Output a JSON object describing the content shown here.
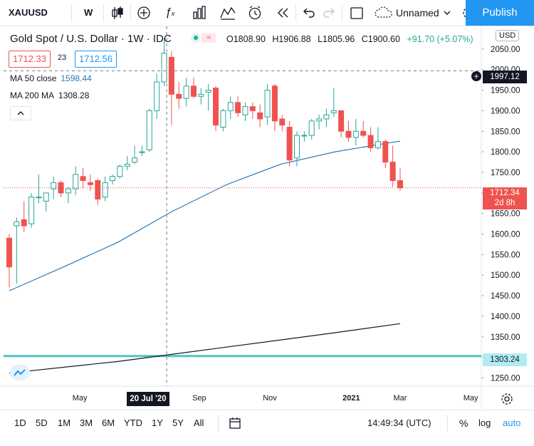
{
  "toolbar": {
    "symbol": "XAUUSD",
    "interval": "W",
    "layout_name": "Unnamed",
    "publish_label": "Publish"
  },
  "legend": {
    "title": "Gold Spot / U.S. Dollar · 1W · IDC",
    "open": "O1808.90",
    "high": "H1906.88",
    "low": "L1805.96",
    "close": "C1900.60",
    "change": "+91.70 (+5.07%)",
    "bid": "1712.33",
    "spread": "23",
    "ask": "1712.56",
    "ma50_label": "MA 50 close",
    "ma50_value": "1598.44",
    "ma200_label": "MA 200 MA",
    "ma200_value": "1308.28"
  },
  "axis": {
    "currency": "USD",
    "crosshair_price": "1997.12",
    "current_price": "1712.34",
    "countdown": "2d 8h",
    "line_price": "1303.24",
    "crosshair_date": "20 Jul '20"
  },
  "bottom": {
    "ranges": [
      "1D",
      "5D",
      "1M",
      "3M",
      "6M",
      "YTD",
      "1Y",
      "5Y",
      "All"
    ],
    "time": "14:49:34 (UTC)",
    "percent": "%",
    "log": "log",
    "auto": "auto"
  },
  "colors": {
    "up": "#26a69a",
    "down": "#ef5350",
    "ma50": "#2c7bb6",
    "ma200": "#131722",
    "hline": "#4fc3c8",
    "accent": "#2196f3"
  },
  "chart_data": {
    "type": "candlestick",
    "title": "Gold Spot / U.S. Dollar · 1W · IDC",
    "ylim": [
      1230,
      2100
    ],
    "y_ticks": [
      1250,
      1300,
      1350,
      1400,
      1450,
      1500,
      1550,
      1600,
      1650,
      1700,
      1750,
      1800,
      1850,
      1900,
      1950,
      2000,
      2050
    ],
    "x_ticks": [
      "May",
      "20 Jul '20",
      "Sep",
      "Nov",
      "2021",
      "Mar",
      "May"
    ],
    "x_tick_weeks": [
      13,
      29,
      35,
      48,
      63,
      72,
      85
    ],
    "week_count": 88,
    "candles": [
      {
        "o": 1590,
        "h": 1600,
        "l": 1470,
        "c": 1520
      },
      {
        "o": 1620,
        "h": 1640,
        "l": 1480,
        "c": 1630
      },
      {
        "o": 1635,
        "h": 1680,
        "l": 1605,
        "c": 1620
      },
      {
        "o": 1625,
        "h": 1700,
        "l": 1615,
        "c": 1690
      },
      {
        "o": 1690,
        "h": 1745,
        "l": 1675,
        "c": 1690
      },
      {
        "o": 1680,
        "h": 1695,
        "l": 1655,
        "c": 1700
      },
      {
        "o": 1710,
        "h": 1740,
        "l": 1685,
        "c": 1725
      },
      {
        "o": 1725,
        "h": 1730,
        "l": 1690,
        "c": 1700
      },
      {
        "o": 1700,
        "h": 1715,
        "l": 1675,
        "c": 1710
      },
      {
        "o": 1710,
        "h": 1765,
        "l": 1695,
        "c": 1745
      },
      {
        "o": 1740,
        "h": 1760,
        "l": 1710,
        "c": 1730
      },
      {
        "o": 1725,
        "h": 1745,
        "l": 1705,
        "c": 1720
      },
      {
        "o": 1730,
        "h": 1735,
        "l": 1670,
        "c": 1685
      },
      {
        "o": 1690,
        "h": 1740,
        "l": 1680,
        "c": 1725
      },
      {
        "o": 1730,
        "h": 1745,
        "l": 1720,
        "c": 1740
      },
      {
        "o": 1740,
        "h": 1770,
        "l": 1735,
        "c": 1765
      },
      {
        "o": 1765,
        "h": 1790,
        "l": 1755,
        "c": 1770
      },
      {
        "o": 1775,
        "h": 1815,
        "l": 1770,
        "c": 1785
      },
      {
        "o": 1800,
        "h": 1815,
        "l": 1790,
        "c": 1800
      },
      {
        "o": 1805,
        "h": 1905,
        "l": 1800,
        "c": 1900
      },
      {
        "o": 1900,
        "h": 1990,
        "l": 1880,
        "c": 1970
      },
      {
        "o": 1970,
        "h": 2075,
        "l": 1960,
        "c": 2040
      },
      {
        "o": 2030,
        "h": 2045,
        "l": 1865,
        "c": 1940
      },
      {
        "o": 1940,
        "h": 1970,
        "l": 1905,
        "c": 1930
      },
      {
        "o": 1930,
        "h": 1980,
        "l": 1910,
        "c": 1960
      },
      {
        "o": 1960,
        "h": 1980,
        "l": 1930,
        "c": 1935
      },
      {
        "o": 1935,
        "h": 1955,
        "l": 1915,
        "c": 1940
      },
      {
        "o": 1945,
        "h": 1965,
        "l": 1900,
        "c": 1950
      },
      {
        "o": 1955,
        "h": 1960,
        "l": 1850,
        "c": 1865
      },
      {
        "o": 1860,
        "h": 1905,
        "l": 1850,
        "c": 1900
      },
      {
        "o": 1900,
        "h": 1935,
        "l": 1880,
        "c": 1920
      },
      {
        "o": 1920,
        "h": 1935,
        "l": 1885,
        "c": 1895
      },
      {
        "o": 1890,
        "h": 1920,
        "l": 1875,
        "c": 1910
      },
      {
        "o": 1910,
        "h": 1920,
        "l": 1880,
        "c": 1900
      },
      {
        "o": 1895,
        "h": 1915,
        "l": 1860,
        "c": 1880
      },
      {
        "o": 1885,
        "h": 1965,
        "l": 1865,
        "c": 1950
      },
      {
        "o": 1960,
        "h": 1965,
        "l": 1850,
        "c": 1875
      },
      {
        "o": 1880,
        "h": 1890,
        "l": 1850,
        "c": 1865
      },
      {
        "o": 1860,
        "h": 1875,
        "l": 1765,
        "c": 1780
      },
      {
        "o": 1785,
        "h": 1850,
        "l": 1765,
        "c": 1840
      },
      {
        "o": 1840,
        "h": 1850,
        "l": 1825,
        "c": 1840
      },
      {
        "o": 1840,
        "h": 1880,
        "l": 1830,
        "c": 1875
      },
      {
        "o": 1875,
        "h": 1890,
        "l": 1855,
        "c": 1880
      },
      {
        "o": 1880,
        "h": 1905,
        "l": 1860,
        "c": 1890
      },
      {
        "o": 1895,
        "h": 1955,
        "l": 1885,
        "c": 1900
      },
      {
        "o": 1900,
        "h": 1900,
        "l": 1835,
        "c": 1850
      },
      {
        "o": 1850,
        "h": 1875,
        "l": 1825,
        "c": 1835
      },
      {
        "o": 1835,
        "h": 1880,
        "l": 1815,
        "c": 1850
      },
      {
        "o": 1850,
        "h": 1875,
        "l": 1835,
        "c": 1840
      },
      {
        "o": 1840,
        "h": 1860,
        "l": 1800,
        "c": 1810
      },
      {
        "o": 1810,
        "h": 1860,
        "l": 1805,
        "c": 1825
      },
      {
        "o": 1825,
        "h": 1830,
        "l": 1760,
        "c": 1775
      },
      {
        "o": 1775,
        "h": 1815,
        "l": 1715,
        "c": 1730
      },
      {
        "o": 1730,
        "h": 1760,
        "l": 1705,
        "c": 1712.34
      }
    ],
    "candle_start_week": 0,
    "ma50": [
      [
        0,
        1462
      ],
      [
        10,
        1520
      ],
      [
        20,
        1580
      ],
      [
        30,
        1655
      ],
      [
        40,
        1720
      ],
      [
        50,
        1770
      ],
      [
        60,
        1800
      ],
      [
        70,
        1822
      ],
      [
        72,
        1826
      ]
    ],
    "ma200": [
      [
        0,
        1262
      ],
      [
        20,
        1290
      ],
      [
        40,
        1325
      ],
      [
        60,
        1360
      ],
      [
        72,
        1382
      ]
    ],
    "hline": 1303.24,
    "crosshair_price": 1997.12,
    "crosshair_week": 29,
    "current_price": 1712.34
  }
}
